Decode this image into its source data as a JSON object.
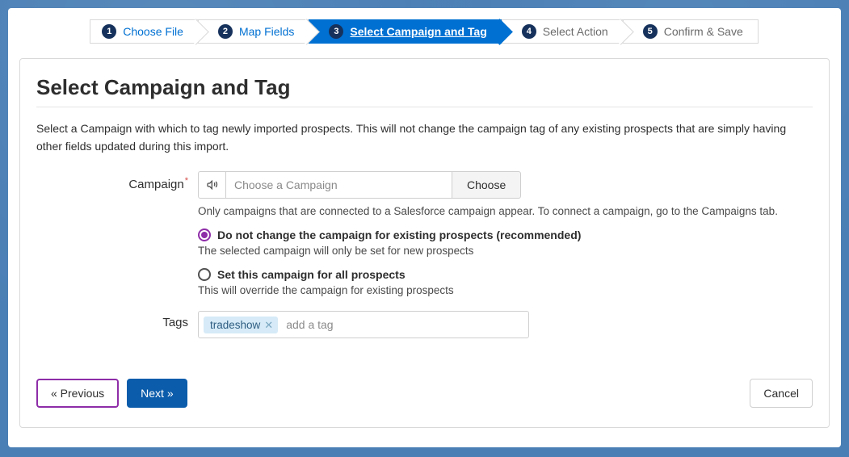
{
  "wizard": {
    "steps": [
      {
        "num": "1",
        "label": "Choose File"
      },
      {
        "num": "2",
        "label": "Map Fields"
      },
      {
        "num": "3",
        "label": "Select Campaign and Tag"
      },
      {
        "num": "4",
        "label": "Select Action"
      },
      {
        "num": "5",
        "label": "Confirm & Save"
      }
    ]
  },
  "page": {
    "title": "Select Campaign and Tag",
    "description": "Select a Campaign with which to tag newly imported prospects. This will not change the campaign tag of any existing prospects that are simply having other fields updated during this import."
  },
  "campaign": {
    "label": "Campaign",
    "required_marker": "*",
    "placeholder": "Choose a Campaign",
    "choose_button": "Choose",
    "helper_text": "Only campaigns that are connected to a Salesforce campaign appear. To connect a campaign, go to the Campaigns tab.",
    "options": {
      "keep": {
        "label": "Do not change the campaign for existing prospects (recommended)",
        "help": "The selected campaign will only be set for new prospects",
        "selected": true
      },
      "setall": {
        "label": "Set this campaign for all prospects",
        "help": "This will override the campaign for existing prospects",
        "selected": false
      }
    }
  },
  "tags": {
    "label": "Tags",
    "items": [
      "tradeshow"
    ],
    "input_placeholder": "add a tag"
  },
  "footer": {
    "previous": "« Previous",
    "next": "Next »",
    "cancel": "Cancel"
  },
  "icons": {
    "bullhorn": "bullhorn-icon",
    "remove": "remove-icon"
  }
}
